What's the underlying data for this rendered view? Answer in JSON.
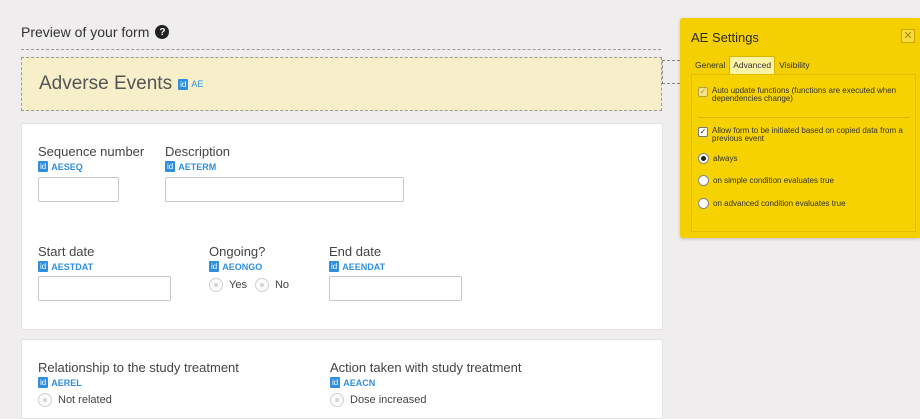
{
  "preview": {
    "title": "Preview of your form",
    "help_icon": "question-circle-icon"
  },
  "form": {
    "title": "Adverse Events",
    "id_badge": "id",
    "code": "AE"
  },
  "fields": {
    "sequence": {
      "label": "Sequence number",
      "badge": "id",
      "code": "AESEQ",
      "value": ""
    },
    "description": {
      "label": "Description",
      "badge": "id",
      "code": "AETERM",
      "value": ""
    },
    "start_date": {
      "label": "Start date",
      "badge": "id",
      "code": "AESTDAT",
      "value": ""
    },
    "ongoing": {
      "label": "Ongoing?",
      "badge": "id",
      "code": "AEONGO",
      "options": [
        "Yes",
        "No"
      ]
    },
    "end_date": {
      "label": "End date",
      "badge": "id",
      "code": "AEENDAT",
      "value": ""
    },
    "relationship": {
      "label": "Relationship to the study treatment",
      "badge": "id",
      "code": "AEREL",
      "options": [
        "Not related"
      ]
    },
    "action": {
      "label": "Action taken with study treatment",
      "badge": "id",
      "code": "AEACN",
      "options": [
        "Dose increased"
      ]
    }
  },
  "settings": {
    "title": "AE Settings",
    "close_icon": "close-icon",
    "close_glyph": "✕",
    "tabs": [
      "General",
      "Advanced",
      "Visibility"
    ],
    "active_tab": "Advanced",
    "auto_update": {
      "label": "Auto update functions (functions are executed when dependencies change)",
      "checked": true,
      "disabled": true,
      "check_glyph": "✓"
    },
    "allow_init": {
      "label": "Allow form to be initiated based on copied data from a previous event",
      "checked": true,
      "check_glyph": "✓"
    },
    "options": [
      {
        "label": "always",
        "checked": true
      },
      {
        "label": "on simple condition evaluates true",
        "checked": false
      },
      {
        "label": "on advanced condition evaluates true",
        "checked": false
      }
    ]
  },
  "colors": {
    "accent": "#2f8fde",
    "settings_bg": "#f5d000",
    "header_bg": "#f6efc9"
  }
}
